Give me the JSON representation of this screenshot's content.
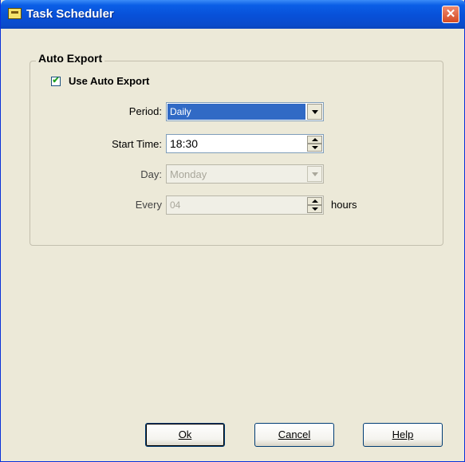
{
  "window": {
    "title": "Task Scheduler",
    "close_label": "✕"
  },
  "auto_export": {
    "group_title": "Auto Export",
    "use_auto_export_label": "Use Auto Export",
    "use_auto_export_checked": true,
    "check_mark": "✔",
    "period": {
      "label": "Period:",
      "value": "Daily"
    },
    "start_time": {
      "label": "Start Time:",
      "value": "18:30"
    },
    "day": {
      "label": "Day:",
      "value": "Monday"
    },
    "every": {
      "label": "Every",
      "value": "04",
      "unit": "hours"
    }
  },
  "buttons": {
    "ok_label": "Ok",
    "cancel_label": "Cancel",
    "help_label": "Help"
  },
  "colors": {
    "title_bar": "#0a5ee6",
    "selection": "#316ac5",
    "dialog_bg": "#ece9d8"
  }
}
